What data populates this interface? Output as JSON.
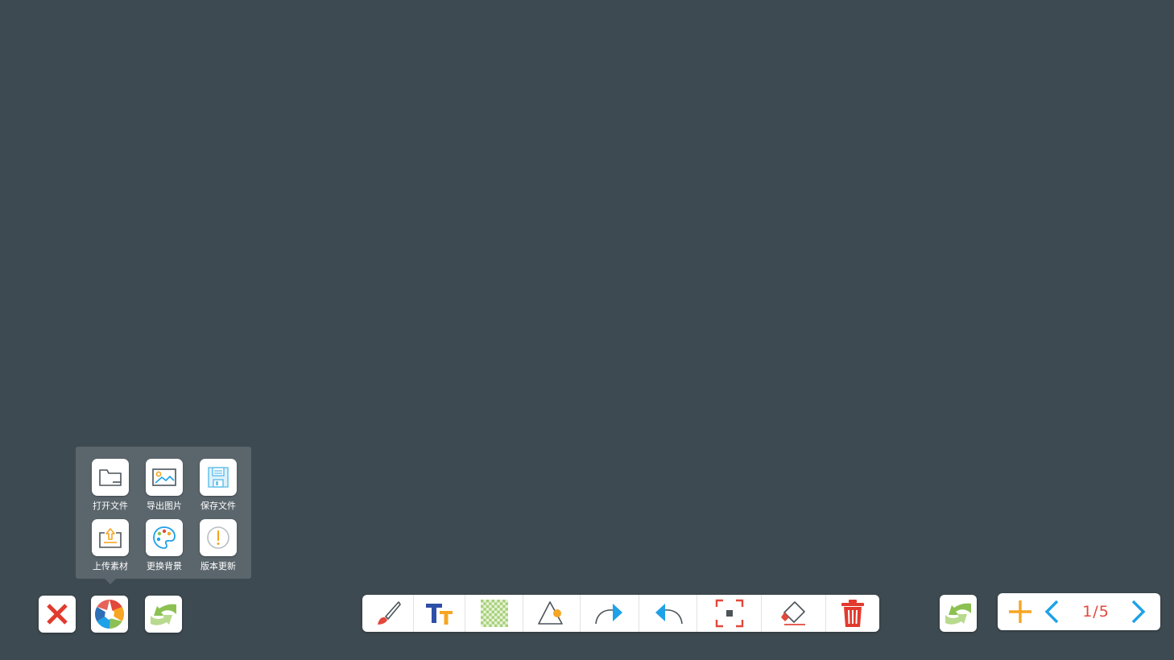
{
  "popup_menu": {
    "items": [
      {
        "label": "打开文件",
        "icon": "folder-icon"
      },
      {
        "label": "导出图片",
        "icon": "image-icon"
      },
      {
        "label": "保存文件",
        "icon": "floppy-disk-icon"
      },
      {
        "label": "上传素材",
        "icon": "upload-icon"
      },
      {
        "label": "更换背景",
        "icon": "palette-icon"
      },
      {
        "label": "版本更新",
        "icon": "info-circle-icon"
      }
    ]
  },
  "left_buttons": [
    {
      "name": "close",
      "icon": "close-x-icon"
    },
    {
      "name": "menu",
      "icon": "aperture-menu-icon"
    },
    {
      "name": "sync",
      "icon": "swap-arrows-icon"
    }
  ],
  "toolbar": {
    "tools": [
      {
        "name": "brush",
        "icon": "brush-icon"
      },
      {
        "name": "text",
        "icon": "text-size-icon"
      },
      {
        "name": "mosaic",
        "icon": "mosaic-grid-icon"
      },
      {
        "name": "shape",
        "icon": "triangle-shape-icon"
      },
      {
        "name": "redo",
        "icon": "redo-arrow-icon"
      },
      {
        "name": "undo",
        "icon": "undo-arrow-icon"
      },
      {
        "name": "select",
        "icon": "selection-frame-icon"
      },
      {
        "name": "eraser",
        "icon": "eraser-icon"
      },
      {
        "name": "delete",
        "icon": "trash-icon"
      }
    ]
  },
  "pager": {
    "current_page": "1/5",
    "icons": [
      "add-page-icon",
      "prev-page-icon",
      "next-page-icon"
    ]
  },
  "colors": {
    "background": "#3e4a51",
    "popup_bg": "#5a656c",
    "accent_red": "#e2483c",
    "accent_blue": "#1da1e8",
    "accent_orange": "#f6a623",
    "accent_green": "#8cc152"
  }
}
